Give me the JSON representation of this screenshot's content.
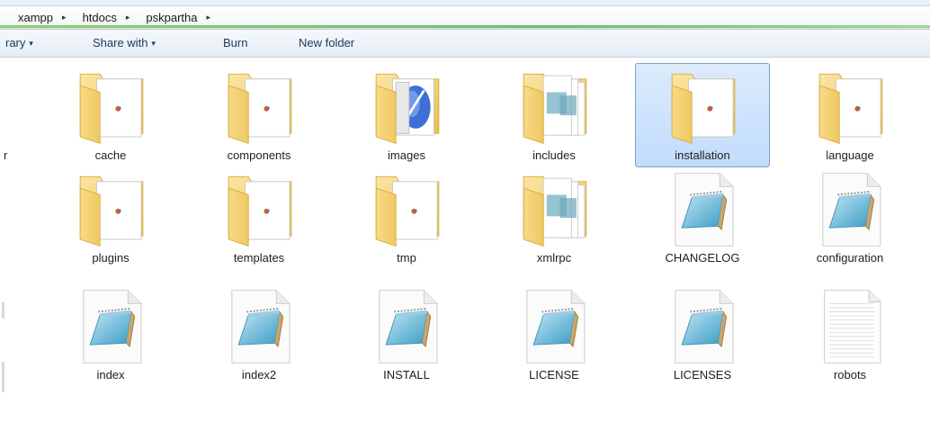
{
  "address_bar": {
    "crumbs": [
      "xampp",
      "htdocs",
      "pskpartha"
    ],
    "separator": "▸"
  },
  "toolbar": {
    "library_label": "rary",
    "share_with_label": "Share with",
    "burn_label": "Burn",
    "new_folder_label": "New folder",
    "caret": "▾"
  },
  "left_pane_clip": "r",
  "items": [
    {
      "name": "cache",
      "type": "folder-doc"
    },
    {
      "name": "components",
      "type": "folder-doc"
    },
    {
      "name": "images",
      "type": "folder-image"
    },
    {
      "name": "includes",
      "type": "folder-stack"
    },
    {
      "name": "installation",
      "type": "folder-doc",
      "selected": true
    },
    {
      "name": "language",
      "type": "folder-doc"
    },
    {
      "name": "plugins",
      "type": "folder-doc"
    },
    {
      "name": "templates",
      "type": "folder-doc"
    },
    {
      "name": "tmp",
      "type": "folder-doc"
    },
    {
      "name": "xmlrpc",
      "type": "folder-stack"
    },
    {
      "name": "CHANGELOG",
      "type": "notepad-file"
    },
    {
      "name": "configuration",
      "type": "notepad-file"
    },
    {
      "name": "index",
      "type": "notepad-file"
    },
    {
      "name": "index2",
      "type": "notepad-file"
    },
    {
      "name": "INSTALL",
      "type": "notepad-file"
    },
    {
      "name": "LICENSE",
      "type": "notepad-file"
    },
    {
      "name": "LICENSES",
      "type": "notepad-file"
    },
    {
      "name": "robots",
      "type": "text-file"
    }
  ],
  "colors": {
    "selection_fill": "#c9e0fc",
    "selection_border": "#7da2ce",
    "folder_yellow": "#f3d57e",
    "notepad_blue": "#5fb7d8"
  }
}
